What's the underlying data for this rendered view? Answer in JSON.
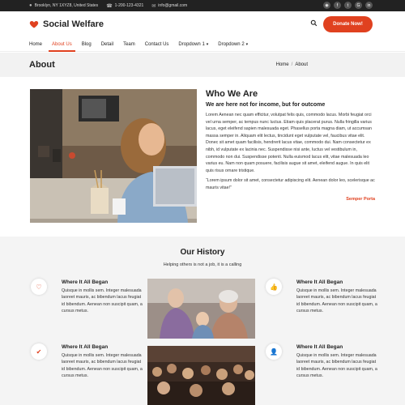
{
  "topbar": {
    "address": "Brooklyn, NY 1XYZ8, United States",
    "phone": "1-200-123-4321",
    "email": "info@gmail.com",
    "social_icons": [
      "rss-icon",
      "facebook-icon",
      "twitter-icon",
      "google-plus-icon",
      "linkedin-icon"
    ]
  },
  "header": {
    "brand": "Social Welfare",
    "donate_label": "Donate Now!"
  },
  "nav": {
    "items": [
      "Home",
      "About Us",
      "Blog",
      "Detail",
      "Team",
      "Contact Us",
      "Dropdown 1",
      "Dropdown 2"
    ],
    "active": "About Us"
  },
  "page_title": "About",
  "breadcrumb": {
    "home": "Home",
    "sep": "/",
    "current": "About"
  },
  "about": {
    "heading": "Who We Are",
    "subheading": "We are here not for income, but for outcome",
    "body": "Lorem Aenean nec quam efficitur, volutpat felis quis, commodo lacus. Morbi feugiat orci vel urna semper, ac tempus nunc luctus. Etiam quis placerat purus. Nulla fringilla varius lacus, eget eleifend sapien malesuada eget. Phasellus porta magna diam, ut accumsan massa semper in. Aliquam elit lectus, tincidunt eget vulputate vel, faucibus vitae elit. Donec sit amet quam facilisis, hendrerit lacus vitae, commodo dui. Nam consectetur ex nibh, id vulputate ex lacinia nec. Suspendisse nisi ante, luctus vel vestibulum in, commodo non dui. Suspendisse potenti. Nulla euismod lacus elit, vitae malesuada leo varius eu. Nam non quam posuere, facilisis augue sit amet, eleifend augue. In quis elit quis risus ornare tristique.",
    "quote": "“Lorem ipsum dolor sit amet, consectetur adipiscing elit. Aenean dolor leo, scelerisque ac mauris vitae!”",
    "author": "Semper Porta"
  },
  "history": {
    "heading": "Our History",
    "subheading": "Helping others is not a job, it is a calling",
    "cards": [
      {
        "icon": "heart-outline-icon",
        "title": "Where It All Began",
        "text": "Quisque in mollis sem. Integer malesuada laoreet mauris, ac bibendum lacus feugiat id bibendum. Aenean non suscipit quam, a cursus metus."
      },
      {
        "icon": "thumbs-up-icon",
        "title": "Where It All Began",
        "text": "Quisque in mollis sem. Integer malesuada laoreet mauris, ac bibendum lacus feugiat id bibendum. Aenean non suscipit quam, a cursus metus."
      },
      {
        "icon": "check-icon",
        "title": "Where It All Began",
        "text": "Quisque in mollis sem. Integer malesuada laoreet mauris, ac bibendum lacus feugiat id bibendum. Aenean non suscipit quam, a cursus metus."
      },
      {
        "icon": "user-plus-icon",
        "title": "Where It All Began",
        "text": "Quisque in mollis sem. Integer malesuada laoreet mauris, ac bibendum lacus feugiat id bibendum. Aenean non suscipit quam, a cursus metus."
      }
    ]
  },
  "colors": {
    "accent": "#e0411f",
    "topbar": "#222222",
    "section_bg": "#f4f4f4"
  }
}
